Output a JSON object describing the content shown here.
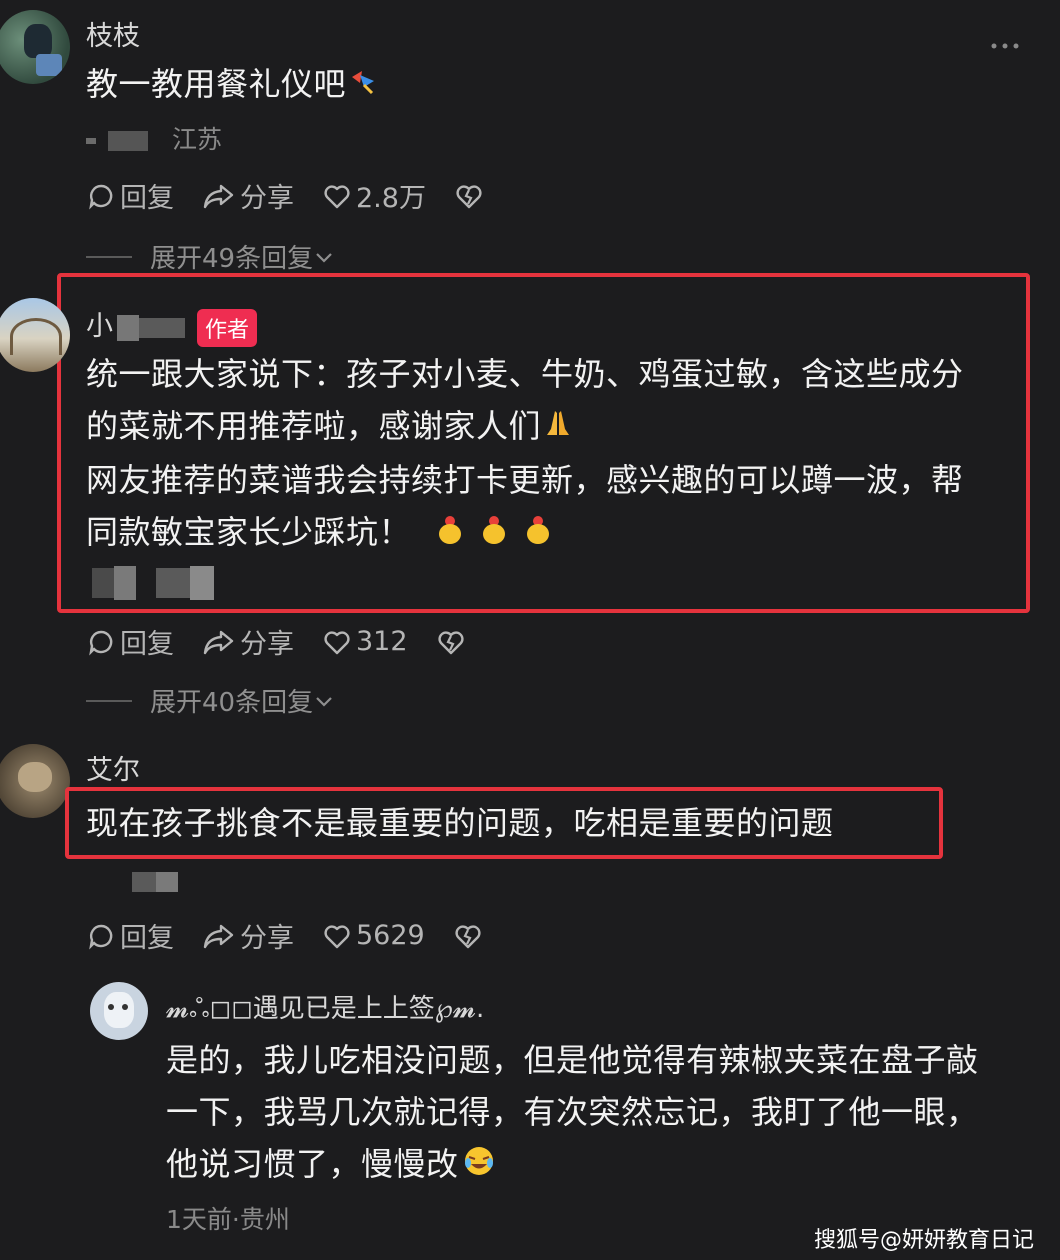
{
  "comments": [
    {
      "username": "枝枝",
      "text_lines": [
        "教一教用餐礼仪吧"
      ],
      "location": "江苏",
      "actions": {
        "reply": "回复",
        "share": "分享",
        "likes": "2.8万"
      },
      "expand": "展开49条回复"
    },
    {
      "username": "小",
      "author_badge": "作者",
      "text_lines": [
        "统一跟大家说下：孩子对小麦、牛奶、鸡蛋过敏，含这些成分",
        "的菜就不用推荐啦，感谢家人们",
        "网友推荐的菜谱我会持续打卡更新，感兴趣的可以蹲一波，帮",
        "同款敏宝家长少踩坑！"
      ],
      "actions": {
        "reply": "回复",
        "share": "分享",
        "likes": "312"
      },
      "expand": "展开40条回复"
    },
    {
      "username": "艾尔",
      "text_lines": [
        "现在孩子挑食不是最重要的问题，吃相是重要的问题"
      ],
      "actions": {
        "reply": "回复",
        "share": "分享",
        "likes": "5629"
      }
    }
  ],
  "reply": {
    "username": "𝓶ஃ◻◻遇见已是上上签℘𝓶.",
    "text_lines": [
      "是的，我儿吃相没问题，但是他觉得有辣椒夹菜在盘子敲",
      "一下，我骂几次就记得，有次突然忘记，我盯了他一眼，",
      "他说习惯了，慢慢改"
    ],
    "meta": "1天前·贵州"
  },
  "watermark": "搜狐号@妍妍教育日记",
  "colors": {
    "background": "#1c1c1e",
    "highlight": "#e5333d",
    "author_badge": "#ef2d51"
  }
}
